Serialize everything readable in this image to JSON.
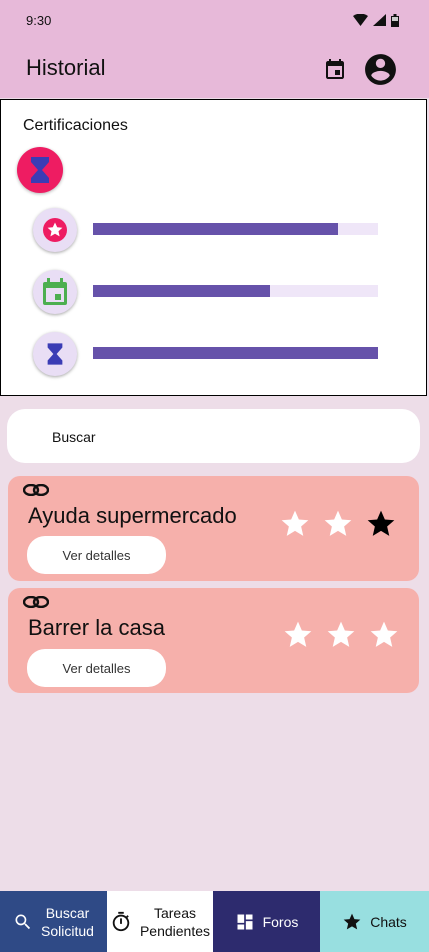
{
  "status_bar": {
    "time": "9:30",
    "icons": [
      "wifi-icon",
      "signal-icon",
      "battery-icon"
    ]
  },
  "app_bar": {
    "title": "Historial",
    "actions": [
      "calendar-icon",
      "account-circle-icon"
    ]
  },
  "certifications": {
    "title": "Certificaciones",
    "main_badge_icon": "hourglass-icon",
    "items": [
      {
        "icon": "star-badge-icon",
        "progress": 0.86
      },
      {
        "icon": "calendar-icon",
        "progress": 0.62
      },
      {
        "icon": "hourglass-icon",
        "progress": 1.0
      }
    ]
  },
  "search": {
    "placeholder": "Buscar"
  },
  "tasks": [
    {
      "name": "Ayuda supermercado",
      "details_label": "Ver detalles",
      "rating": 3,
      "star_style": [
        "outline-white",
        "outline-white",
        "filled-black"
      ]
    },
    {
      "name": "Barrer la casa",
      "details_label": "Ver detalles",
      "rating": 3,
      "star_style": [
        "outline-white",
        "outline-white",
        "outline-white"
      ]
    }
  ],
  "bottom_nav": [
    {
      "label_line1": "Buscar",
      "label_line2": "Solicitud",
      "icon": "search-icon"
    },
    {
      "label_line1": "Tareas",
      "label_line2": "Pendientes",
      "icon": "timer-icon"
    },
    {
      "label_line1": "Foros",
      "label_line2": "",
      "icon": "dashboard-icon"
    },
    {
      "label_line1": "Chats",
      "label_line2": "",
      "icon": "star-icon"
    }
  ],
  "colors": {
    "app_bar": "#e7b9d9",
    "background": "#eddde8",
    "accent_pink": "#ee1c62",
    "progress": "#6652aa",
    "task_card": "#f6b0ab"
  }
}
